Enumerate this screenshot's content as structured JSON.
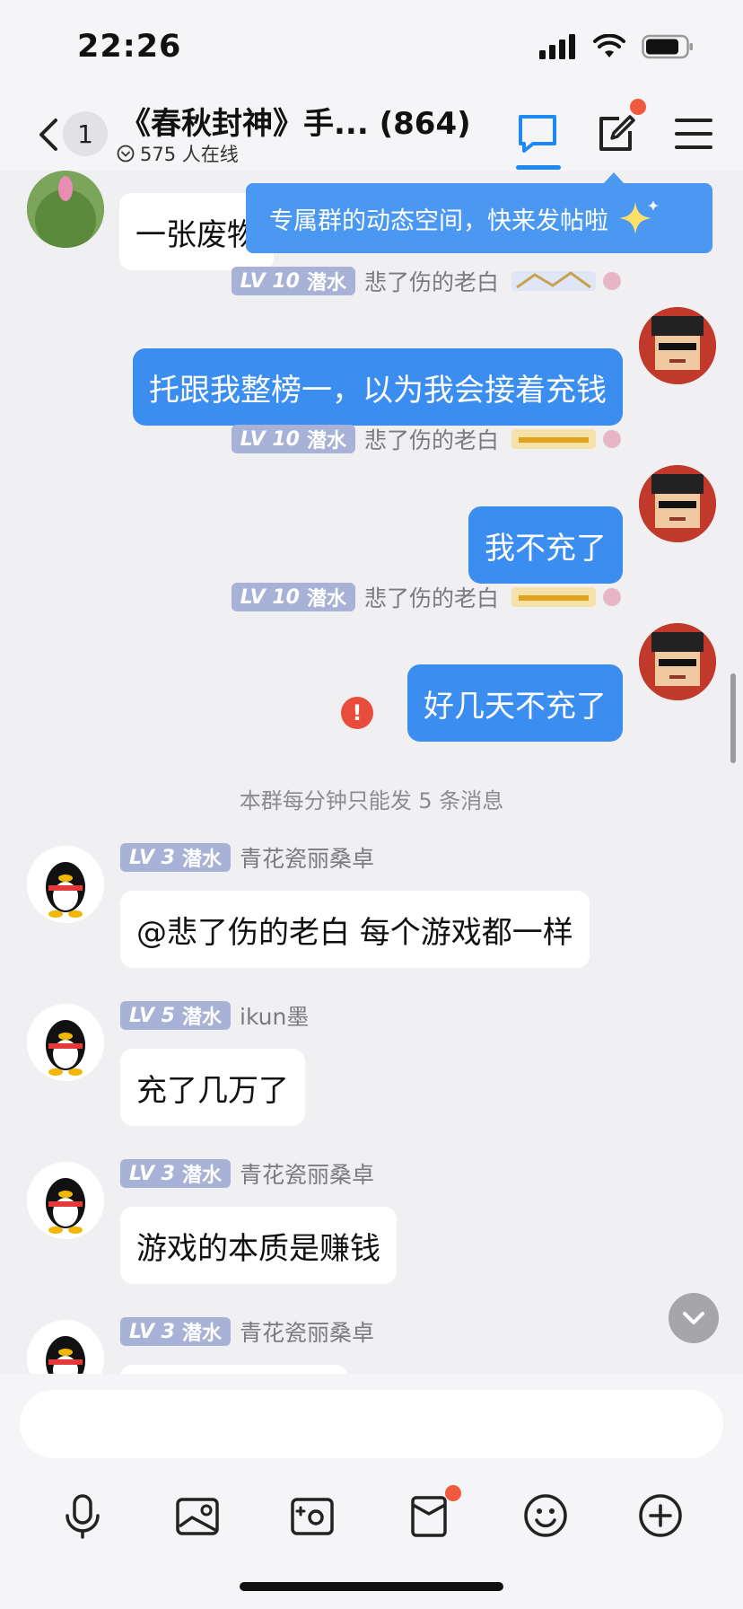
{
  "status_bar": {
    "time": "22:26"
  },
  "header": {
    "unread_count": "1",
    "title": "《春秋封神》手...",
    "member_count": "(864)",
    "online_text": "575 人在线"
  },
  "tooltip": {
    "text": "专属群的动态空间，快来发帖啦"
  },
  "messages": [
    {
      "bubble": "一张废物"
    },
    {
      "level": "LV 10",
      "role": "潜水",
      "name": "悲了伤的老白",
      "bubble": "托跟我整榜一，以为我会接着充钱"
    },
    {
      "level": "LV 10",
      "role": "潜水",
      "name": "悲了伤的老白",
      "bubble": "我不充了"
    },
    {
      "level": "LV 10",
      "role": "潜水",
      "name": "悲了伤的老白",
      "bubble": "好几天不充了",
      "error": "!"
    },
    {
      "level": "LV 3",
      "role": "潜水",
      "name": "青花瓷丽桑卓",
      "bubble": "@悲了伤的老白 每个游戏都一样"
    },
    {
      "level": "LV 5",
      "role": "潜水",
      "name": "ikun墨",
      "bubble": "充了几万了"
    },
    {
      "level": "LV 3",
      "role": "潜水",
      "name": "青花瓷丽桑卓",
      "bubble": "游戏的本质是赚钱"
    },
    {
      "level": "LV 3",
      "role": "潜水",
      "name": "青花瓷丽桑卓"
    }
  ],
  "system_note": "本群每分钟只能发 5 条消息",
  "colors": {
    "accent": "#1e88f5",
    "bubble_out": "#3b8ef0",
    "badge": "#a8b2d6",
    "notify": "#f05a3c"
  },
  "toolbar_icons": [
    "microphone-icon",
    "image-icon",
    "camera-icon",
    "red-packet-icon",
    "emoji-icon",
    "plus-icon"
  ]
}
